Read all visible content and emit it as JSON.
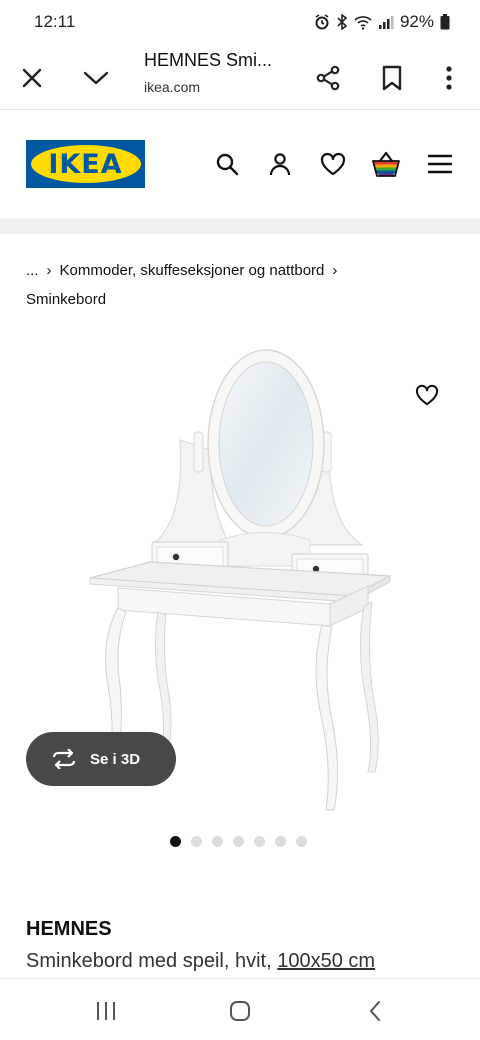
{
  "status_bar": {
    "time": "12:11",
    "battery": "92%",
    "icons": [
      "alarm-icon",
      "bluetooth-icon",
      "wifi-icon",
      "signal-icon",
      "battery-icon"
    ]
  },
  "browser": {
    "page_title": "HEMNES Smi...",
    "domain": "ikea.com",
    "icons": [
      "close-icon",
      "chevron-down-icon",
      "share-icon",
      "bookmark-icon",
      "more-icon"
    ]
  },
  "header": {
    "logo_text": "IKEA",
    "icons": [
      "search-icon",
      "account-icon",
      "favourites-icon",
      "cart-icon",
      "menu-icon"
    ]
  },
  "breadcrumb": {
    "ellipsis": "...",
    "category": "Kommoder, skuffeseksjoner og nattbord",
    "current": "Sminkebord"
  },
  "gallery": {
    "view_3d_label": "Se i 3D",
    "dots_total": 7,
    "active_dot": 0
  },
  "product": {
    "name": "HEMNES",
    "description": "Sminkebord med speil, hvit,",
    "size": "100x50 cm"
  },
  "colors": {
    "ikea_blue": "#0058a3",
    "ikea_yellow": "#ffdb00",
    "button_dark": "#484848"
  }
}
